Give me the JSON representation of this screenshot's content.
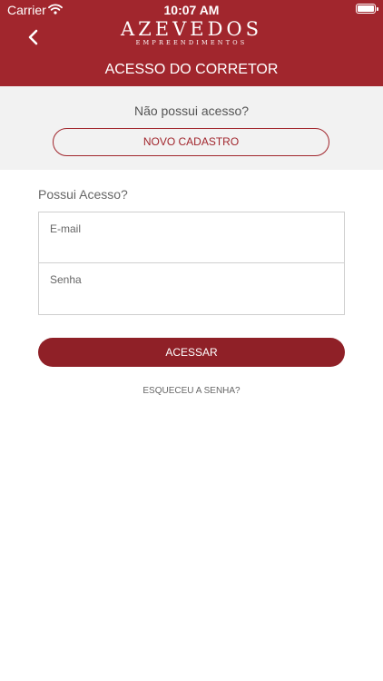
{
  "status_bar": {
    "carrier": "Carrier",
    "time": "10:07 AM"
  },
  "header": {
    "logo_title": "AZEVEDOS",
    "logo_subtitle": "EMPREENDIMENTOS",
    "page_title": "ACESSO DO CORRETOR",
    "icons": {
      "back": "chevron-left-icon"
    }
  },
  "register": {
    "prompt": "Não possui acesso?",
    "button_label": "NOVO CADASTRO"
  },
  "login": {
    "prompt": "Possui Acesso?",
    "email_label": "E-mail",
    "password_label": "Senha",
    "submit_label": "ACESSAR",
    "forgot_label": "ESQUECEU A SENHA?"
  },
  "colors": {
    "brand": "#a1262d",
    "button": "#8f2027",
    "section_bg": "#f2f2f2"
  }
}
